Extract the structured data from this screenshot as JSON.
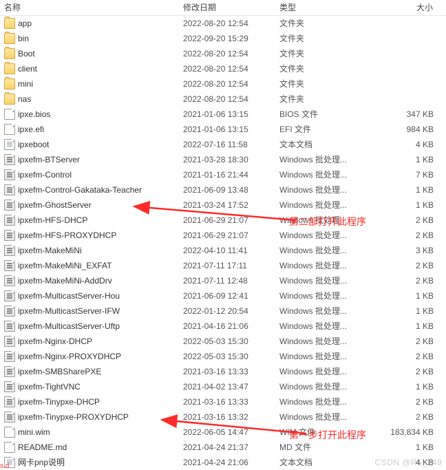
{
  "columns": {
    "name": "名称",
    "date": "修改日期",
    "type": "类型",
    "size": "大小"
  },
  "rows": [
    {
      "icon": "folder",
      "name": "app",
      "date": "2022-08-20 12:54",
      "type": "文件夹",
      "size": ""
    },
    {
      "icon": "folder",
      "name": "bin",
      "date": "2022-09-20 15:29",
      "type": "文件夹",
      "size": ""
    },
    {
      "icon": "folder",
      "name": "Boot",
      "date": "2022-08-20 12:54",
      "type": "文件夹",
      "size": ""
    },
    {
      "icon": "folder",
      "name": "client",
      "date": "2022-08-20 12:54",
      "type": "文件夹",
      "size": ""
    },
    {
      "icon": "folder",
      "name": "mini",
      "date": "2022-08-20 12:54",
      "type": "文件夹",
      "size": ""
    },
    {
      "icon": "folder",
      "name": "nas",
      "date": "2022-08-20 12:54",
      "type": "文件夹",
      "size": ""
    },
    {
      "icon": "file",
      "name": "ipxe.bios",
      "date": "2021-01-06 13:15",
      "type": "BIOS 文件",
      "size": "347 KB"
    },
    {
      "icon": "file",
      "name": "ipxe.efi",
      "date": "2021-01-06 13:15",
      "type": "EFI 文件",
      "size": "984 KB"
    },
    {
      "icon": "txt",
      "name": "ipxeboot",
      "date": "2022-07-16 11:58",
      "type": "文本文档",
      "size": "4 KB"
    },
    {
      "icon": "bat",
      "name": "ipxefm-BTServer",
      "date": "2021-03-28 18:30",
      "type": "Windows 批处理...",
      "size": "1 KB"
    },
    {
      "icon": "bat",
      "name": "ipxefm-Control",
      "date": "2021-01-16 21:44",
      "type": "Windows 批处理...",
      "size": "7 KB"
    },
    {
      "icon": "bat",
      "name": "ipxefm-Control-Gakataka-Teacher",
      "date": "2021-06-09 13:48",
      "type": "Windows 批处理...",
      "size": "1 KB"
    },
    {
      "icon": "bat",
      "name": "ipxefm-GhostServer",
      "date": "2021-03-24 17:52",
      "type": "Windows 批处理...",
      "size": "1 KB"
    },
    {
      "icon": "bat",
      "name": "ipxefm-HFS-DHCP",
      "date": "2021-06-29 21:07",
      "type": "Windows 批处理...",
      "size": "2 KB"
    },
    {
      "icon": "bat",
      "name": "ipxefm-HFS-PROXYDHCP",
      "date": "2021-06-29 21:07",
      "type": "Windows 批处理...",
      "size": "2 KB"
    },
    {
      "icon": "bat",
      "name": "ipxefm-MakeMiNi",
      "date": "2022-04-10 11:41",
      "type": "Windows 批处理...",
      "size": "3 KB"
    },
    {
      "icon": "bat",
      "name": "ipxefm-MakeMiNi_EXFAT",
      "date": "2021-07-11 17:11",
      "type": "Windows 批处理...",
      "size": "2 KB"
    },
    {
      "icon": "bat",
      "name": "ipxefm-MakeMiNi-AddDrv",
      "date": "2021-07-11 12:48",
      "type": "Windows 批处理...",
      "size": "2 KB"
    },
    {
      "icon": "bat",
      "name": "ipxefm-MulticastServer-Hou",
      "date": "2021-06-09 12:41",
      "type": "Windows 批处理...",
      "size": "1 KB"
    },
    {
      "icon": "bat",
      "name": "ipxefm-MulticastServer-IFW",
      "date": "2022-01-12 20:54",
      "type": "Windows 批处理...",
      "size": "1 KB"
    },
    {
      "icon": "bat",
      "name": "ipxefm-MulticastServer-Uftp",
      "date": "2021-04-16 21:06",
      "type": "Windows 批处理...",
      "size": "1 KB"
    },
    {
      "icon": "bat",
      "name": "ipxefm-Nginx-DHCP",
      "date": "2022-05-03 15:30",
      "type": "Windows 批处理...",
      "size": "2 KB"
    },
    {
      "icon": "bat",
      "name": "ipxefm-Nginx-PROXYDHCP",
      "date": "2022-05-03 15:30",
      "type": "Windows 批处理...",
      "size": "2 KB"
    },
    {
      "icon": "bat",
      "name": "ipxefm-SMBSharePXE",
      "date": "2021-03-16 13:33",
      "type": "Windows 批处理...",
      "size": "2 KB"
    },
    {
      "icon": "bat",
      "name": "ipxefm-TightVNC",
      "date": "2021-04-02 13:47",
      "type": "Windows 批处理...",
      "size": "1 KB"
    },
    {
      "icon": "bat",
      "name": "ipxefm-Tinypxe-DHCP",
      "date": "2021-03-16 13:33",
      "type": "Windows 批处理...",
      "size": "2 KB"
    },
    {
      "icon": "bat",
      "name": "ipxefm-Tinypxe-PROXYDHCP",
      "date": "2021-03-16 13:32",
      "type": "Windows 批处理...",
      "size": "2 KB"
    },
    {
      "icon": "file",
      "name": "mini.wim",
      "date": "2022-06-05 14:47",
      "type": "WIM 文件",
      "size": "183,834 KB"
    },
    {
      "icon": "file",
      "name": "README.md",
      "date": "2021-04-24 21:37",
      "type": "MD 文件",
      "size": "1 KB"
    },
    {
      "icon": "txt",
      "name": "网卡pnp说明",
      "date": "2021-04-24 21:06",
      "type": "文本文档",
      "size": "4 KB"
    }
  ],
  "annotations": {
    "step2": "第二部打开此程序",
    "step1": "第一步打开此程序"
  },
  "watermark": "CSDN @Ru_349",
  "corner": "s.d"
}
